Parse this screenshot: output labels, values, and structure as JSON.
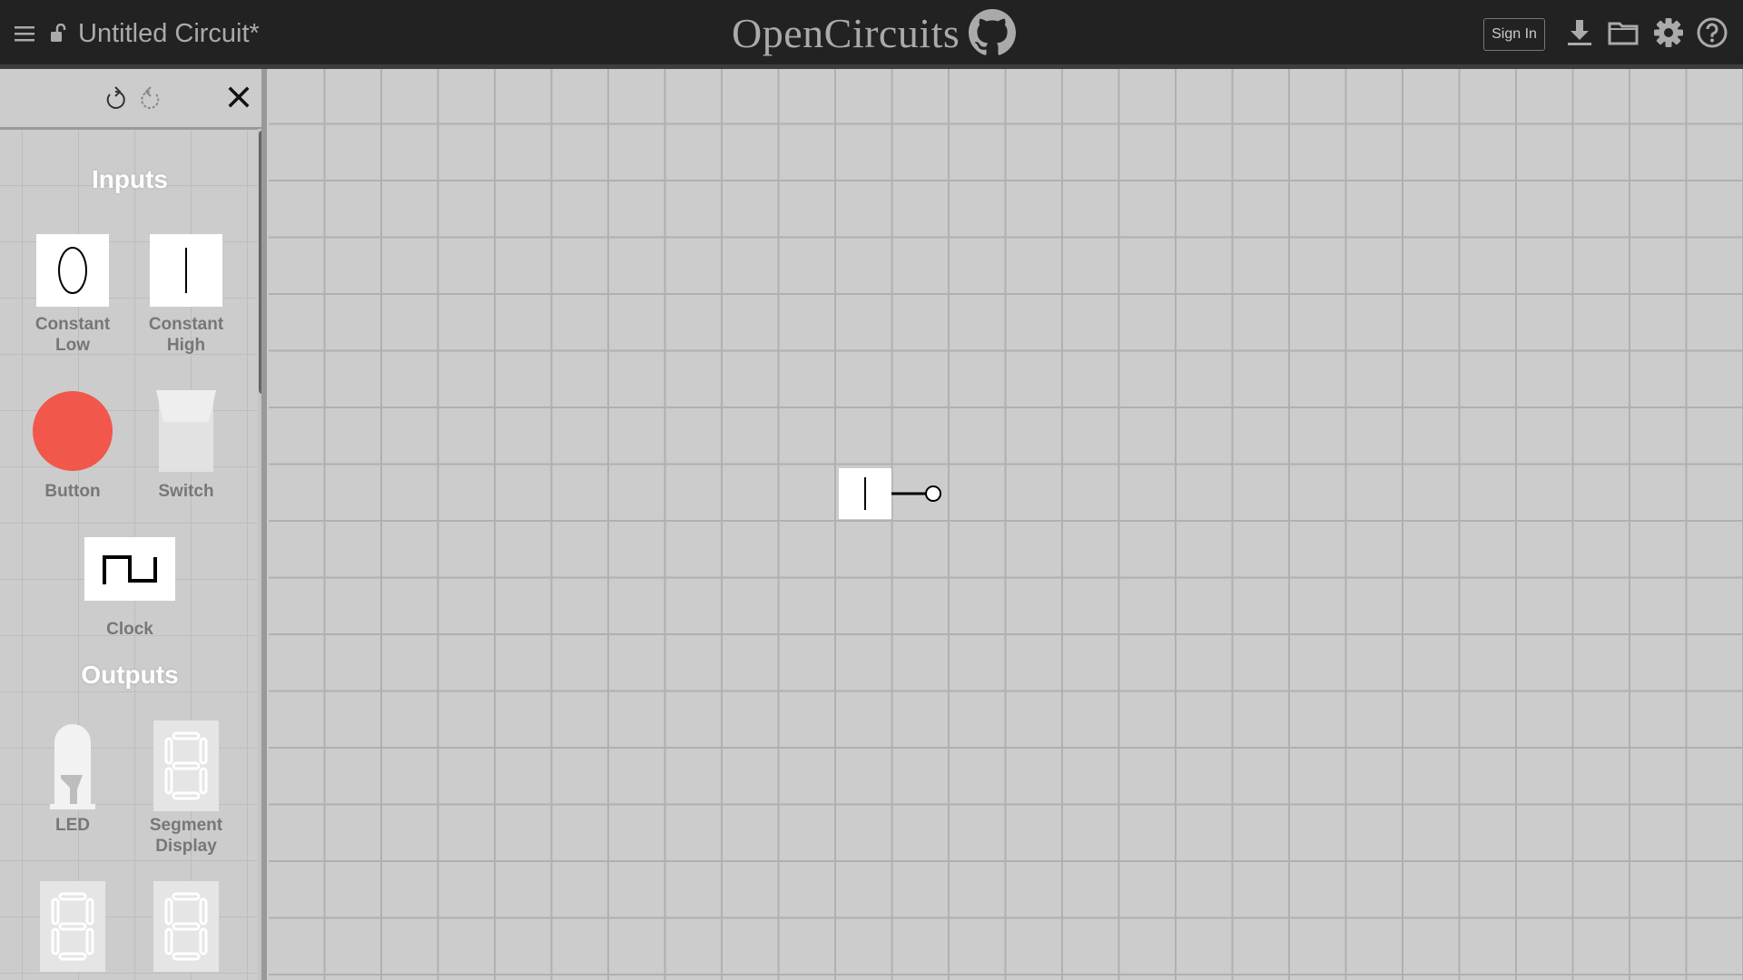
{
  "header": {
    "circuit_name": "Untitled Circuit*",
    "brand": "OpenCircuits",
    "sign_in": "Sign In",
    "icons": [
      "menu-icon",
      "lock-icon",
      "github-icon",
      "download-icon",
      "folder-icon",
      "gear-icon",
      "help-icon"
    ]
  },
  "sidebar": {
    "undo_icon": "undo-icon",
    "redo_icon": "redo-icon",
    "close_icon": "close-icon",
    "sections": [
      {
        "title": "Inputs",
        "items": [
          "Constant Low",
          "Constant High",
          "Button",
          "Switch",
          "Clock"
        ]
      },
      {
        "title": "Outputs",
        "items": [
          "LED",
          "Segment Display"
        ]
      }
    ],
    "item_labels": {
      "constant_low": [
        "Constant",
        "Low"
      ],
      "constant_high": [
        "Constant",
        "High"
      ],
      "button": "Button",
      "switch": "Switch",
      "clock": "Clock",
      "led": "LED",
      "segment_display": [
        "Segment",
        "Display"
      ]
    }
  },
  "canvas": {
    "components": [
      {
        "type": "Constant High",
        "symbol": "|"
      }
    ]
  },
  "colors": {
    "topbar": "#222222",
    "canvas_bg": "#cccccc",
    "grid": "#b0b0b0",
    "button_red": "#f1574a",
    "label_gray": "#777777"
  }
}
